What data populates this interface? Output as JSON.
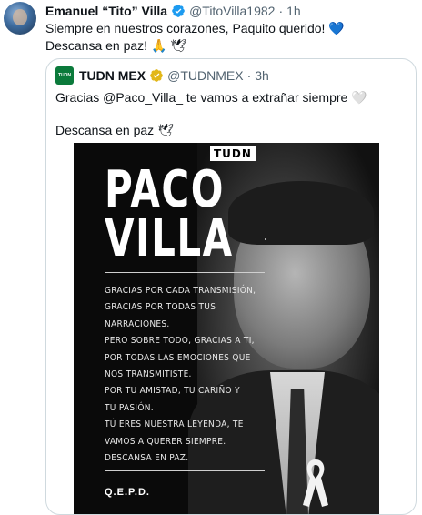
{
  "tweet": {
    "author_name": "Emanuel “Tito” Villa",
    "author_handle": "@TitoVilla1982",
    "separator": "·",
    "timestamp": "1h",
    "text_line1": "Siempre en nuestros corazones, Paquito querido! 💙",
    "text_line2": "Descansa en paz! 🙏 🕊"
  },
  "quote": {
    "avatar_text": "TUDN",
    "author_name": "TUDN MEX",
    "author_handle": "@TUDNMEX",
    "separator": "·",
    "timestamp": "3h",
    "text_line1": "Gracias @Paco_Villa_ te vamos a extrañar siempre 🤍",
    "text_line2": "Descansa en paz 🕊"
  },
  "poster": {
    "brand": "TUDN",
    "title_line1": "PACO",
    "title_line2": "VILLA",
    "message_lines": [
      "GRACIAS POR CADA TRANSMISIÓN,",
      "GRACIAS POR TODAS TUS",
      "NARRACIONES.",
      "PERO SOBRE TODO, GRACIAS A TI,",
      "POR TODAS LAS EMOCIONES QUE",
      "NOS TRANSMITISTE.",
      "POR TU AMISTAD, TU CARIÑO Y",
      "TU PASIÓN.",
      "TÚ ERES NUESTRA LEYENDA, TE",
      "VAMOS A QUERER SIEMPRE.",
      "DESCANSA EN PAZ."
    ],
    "footer": "Q.E.P.D."
  },
  "icons": {
    "verified_badge": "verified-blue-check",
    "gold_badge": "verified-gold-check",
    "ribbon": "mourning-ribbon-icon"
  },
  "colors": {
    "verified_blue": "#1d9bf0",
    "verified_gold": "#e2b719",
    "secondary_text": "#536471",
    "tudn_green": "#0b7a3b"
  }
}
